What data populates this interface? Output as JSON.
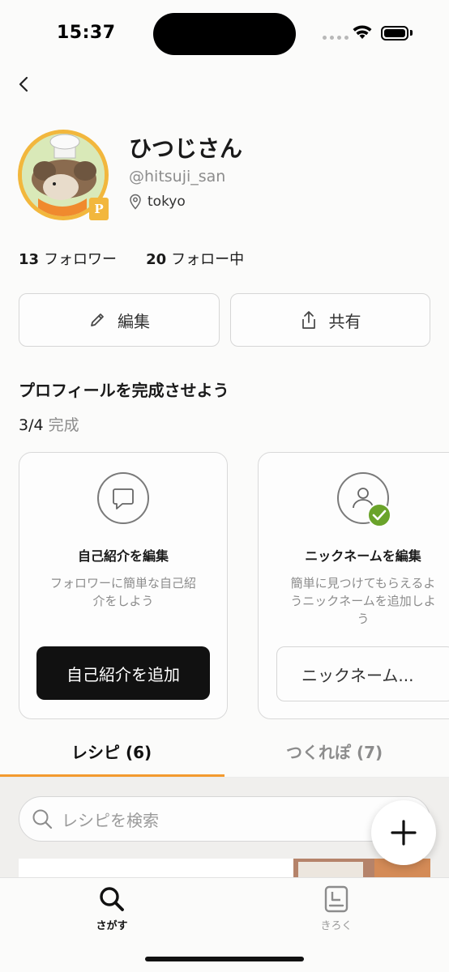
{
  "status_bar": {
    "time": "15:37"
  },
  "profile": {
    "name": "ひつじさん",
    "handle": "@hitsuji_san",
    "location": "tokyo",
    "badge": "P",
    "followers_count": "13",
    "followers_label": "フォロワー",
    "following_count": "20",
    "following_label": "フォロー中"
  },
  "actions": {
    "edit_label": "編集",
    "share_label": "共有"
  },
  "completion": {
    "title": "プロフィールを完成させよう",
    "progress": "3/4",
    "progress_suffix": "完成",
    "cards": [
      {
        "title": "自己紹介を編集",
        "desc_line1": "フォロワーに簡単な自己紹",
        "desc_line2": "介をしよう",
        "button": "自己紹介を追加"
      },
      {
        "title": "ニックネームを編集",
        "desc_line1": "簡単に見つけてもらえるよ",
        "desc_line2": "うニックネームを追加しよ",
        "desc_line3": "う",
        "button": "ニックネーム..."
      }
    ]
  },
  "tabs": [
    {
      "label": "レシピ (6)",
      "active": true
    },
    {
      "label": "つくれぽ (7)",
      "active": false
    }
  ],
  "search": {
    "placeholder": "レシピを検索"
  },
  "bottom_nav": [
    {
      "label": "さがす",
      "icon": "search-icon",
      "active": true
    },
    {
      "label": "きろく",
      "icon": "book-icon",
      "active": false
    }
  ],
  "colors": {
    "accent": "#f39a2e",
    "avatar_ring": "#f2b73d",
    "check_green": "#6aa32a"
  }
}
